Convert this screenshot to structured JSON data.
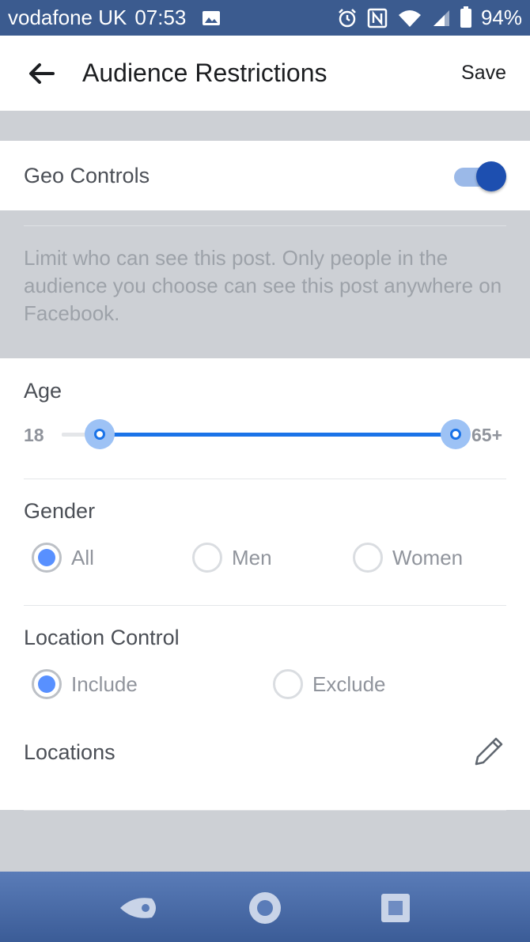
{
  "status_bar": {
    "carrier": "vodafone UK",
    "time": "07:53",
    "battery": "94%",
    "icons": [
      "image-icon",
      "alarm-icon",
      "nfc-icon",
      "wifi-icon",
      "signal-icon",
      "battery-icon"
    ]
  },
  "header": {
    "title": "Audience Restrictions",
    "save_label": "Save",
    "back_icon": "arrow-left-icon"
  },
  "geo_controls": {
    "label": "Geo Controls",
    "enabled": true,
    "description": "Limit who can see this post. Only people in the audience you choose can see this post anywhere on Facebook."
  },
  "age": {
    "label": "Age",
    "min_label": "18",
    "max_label": "65+",
    "min_value": 18,
    "max_value": 65
  },
  "gender": {
    "label": "Gender",
    "options": [
      "All",
      "Men",
      "Women"
    ],
    "selected": "All"
  },
  "location_control": {
    "label": "Location Control",
    "options": [
      "Include",
      "Exclude"
    ],
    "selected": "Include"
  },
  "locations": {
    "label": "Locations",
    "edit_icon": "pencil-icon"
  },
  "nav_bar": {
    "icons": [
      "back-icon",
      "home-icon",
      "recents-icon"
    ]
  },
  "colors": {
    "status_bar": "#3b5b8f",
    "accent": "#1a73e8",
    "toggle_knob": "#1d4fb0",
    "radio_selected": "#5890ff",
    "panel_gray": "#cdd0d5"
  }
}
